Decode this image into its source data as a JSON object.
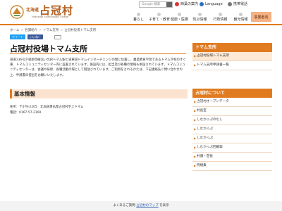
{
  "header": {
    "logo_small": "北海道",
    "logo_big": "占冠村",
    "logo_sub": "Hokkaido Shimukappu Village",
    "search_placeholder": "Google 検索",
    "util": {
      "anshin": "防災・安心",
      "western": "西葉の案内",
      "language": "Language",
      "mobile": "携帯電話"
    }
  },
  "gnav": [
    "暮らし",
    "子育て・教育",
    "健康・医療",
    "防災情報",
    "行政情報",
    "観光情報",
    "事業者向"
  ],
  "breadcrumb": [
    "ホーム",
    "各課紹介",
    "トマム支所",
    "占冠村役場トマム支所"
  ],
  "social": {
    "tweet": "ツイート",
    "like": "いいね！"
  },
  "main": {
    "title": "占冠村役場トマム支所",
    "body": "道道136号夕張新得線沿いのJRトマム駅と道東道トマムインターチェンジの間に位置し、農業教育学習であるトマム学校のすぐ東、トマムコミュニティセンター内に設置されています。施設内には、担当及び各種の情報も併設されています。トマムコミュニティセンターは、会議や研修、各種活動の場として開放されています。ご利用をされるかたは、下記連絡先に問い合わせの上、申請書の提出をお願いいたします。",
    "section_title": "基本情報",
    "address": "住所：〒079-2205　北海道勇払郡占冠村字上トマム",
    "phone": "電話：0167-57-2160"
  },
  "sidebar1": {
    "title": "トマム支所",
    "items": [
      "占冠村役場トマム支所",
      "トマム支所申請書一覧"
    ]
  },
  "sidebar2": {
    "title": "占冠村について",
    "items": [
      "占冠村オープンデータ",
      "村長室",
      "しむかっぷのむし",
      "しむかっぷ",
      "しむかっぷ",
      "しむかっぷ回顧録",
      "村議・首長",
      "例規集"
    ]
  },
  "footer": {
    "prefix": "よくあるご質問",
    "link": "占冠村のマップ",
    "suffix": "を表示"
  },
  "colors": {
    "accent": "#e07b20",
    "brand": "#b15a1a"
  }
}
